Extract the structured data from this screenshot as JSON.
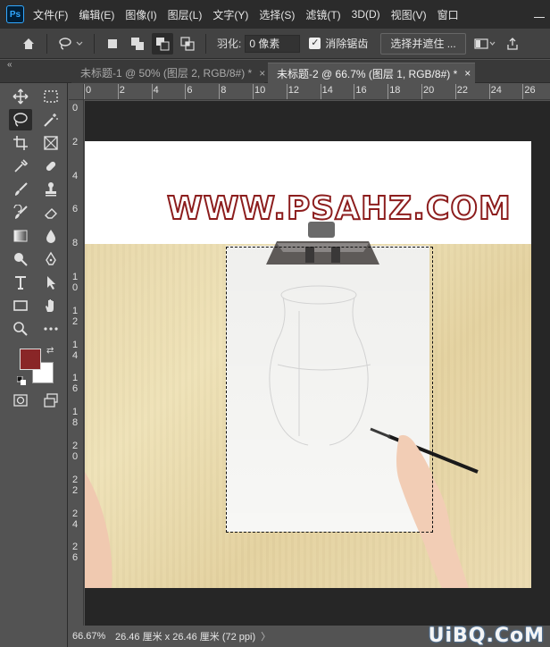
{
  "app": {
    "logo_text": "Ps",
    "menus": [
      "文件(F)",
      "编辑(E)",
      "图像(I)",
      "图层(L)",
      "文字(Y)",
      "选择(S)",
      "滤镜(T)",
      "3D(D)",
      "视图(V)",
      "窗口"
    ]
  },
  "options": {
    "feather_label": "羽化:",
    "feather_value": "0 像素",
    "antialias_label": "消除锯齿",
    "antialias_checked": true,
    "select_mask_label": "选择并遮住 ..."
  },
  "tabs": [
    {
      "label": "未标题-1 @ 50% (图层 2, RGB/8#) *",
      "active": false
    },
    {
      "label": "未标题-2 @ 66.7% (图层 1, RGB/8#) *",
      "active": true
    }
  ],
  "ruler_top": [
    "0",
    "2",
    "4",
    "6",
    "8",
    "10",
    "12",
    "14",
    "16",
    "18",
    "20",
    "22",
    "24",
    "26"
  ],
  "ruler_left": [
    "0",
    "2",
    "4",
    "6",
    "8",
    "1 0",
    "1 2",
    "1 4",
    "1 6",
    "1 8",
    "2 0",
    "2 2",
    "2 4",
    "2 6"
  ],
  "colors": {
    "foreground": "#892627",
    "background": "#ffffff"
  },
  "canvas": {
    "watermark": "WWW.PSAHZ.COM"
  },
  "status": {
    "zoom": "66.67%",
    "doc_info": "26.46 厘米 x 26.46 厘米 (72 ppi)"
  },
  "site_logo": "UiBQ.CoM"
}
